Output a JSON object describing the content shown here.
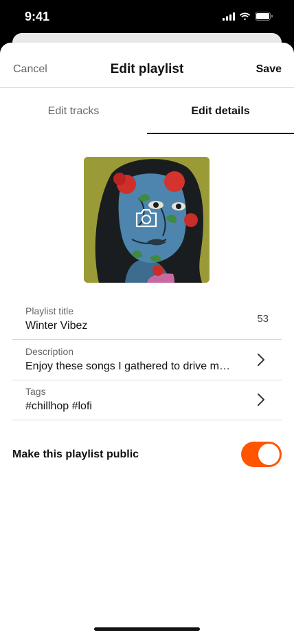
{
  "status_bar": {
    "time": "9:41",
    "icons": [
      "cellular-signal-icon",
      "wifi-icon",
      "battery-icon"
    ]
  },
  "nav": {
    "cancel_label": "Cancel",
    "title": "Edit playlist",
    "save_label": "Save"
  },
  "tabs": [
    {
      "label": "Edit tracks",
      "active": false
    },
    {
      "label": "Edit details",
      "active": true
    }
  ],
  "artwork": {
    "icon": "camera-icon"
  },
  "fields": {
    "title": {
      "label": "Playlist title",
      "value": "Winter Vibez",
      "count": "53"
    },
    "description": {
      "label": "Description",
      "value": "Enjoy these songs I gathered to drive m…"
    },
    "tags": {
      "label": "Tags",
      "value": "#chillhop #lofi"
    }
  },
  "public_toggle": {
    "label": "Make this playlist public",
    "on": true
  },
  "colors": {
    "accent": "#ff5500",
    "text_primary": "#111111",
    "text_secondary": "#666666",
    "divider": "#d8d8d8"
  }
}
